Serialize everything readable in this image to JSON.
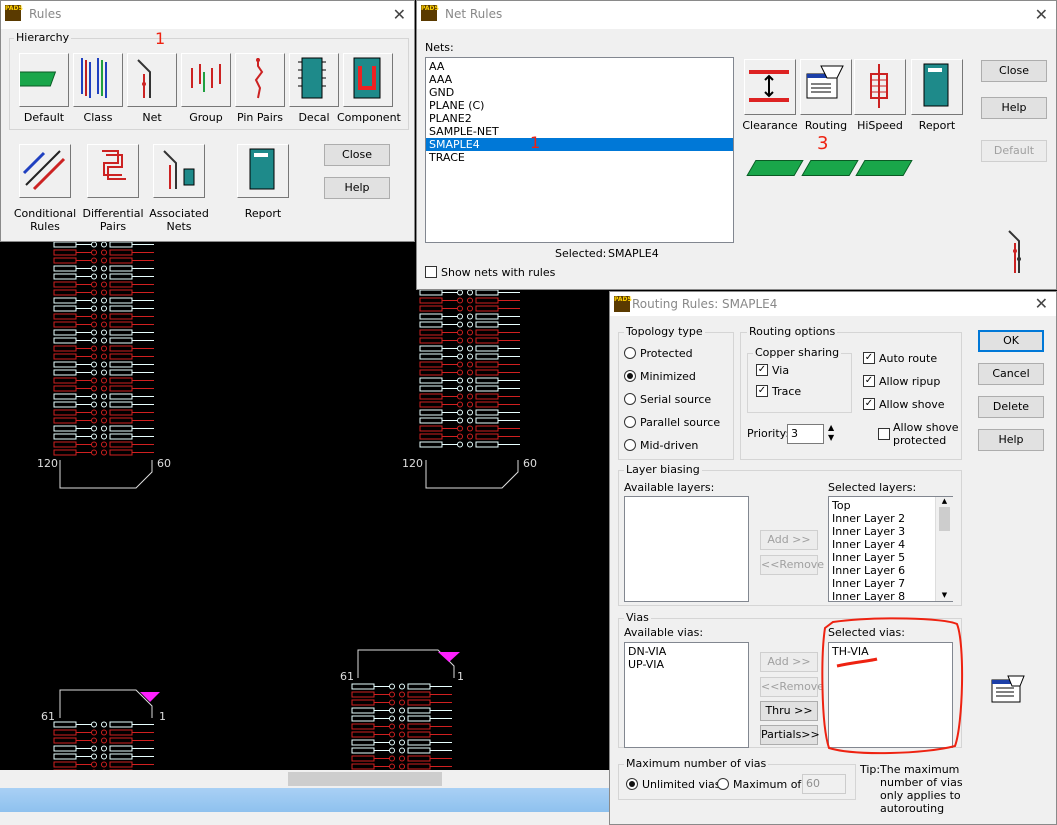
{
  "rules_window": {
    "title": "Rules",
    "hierarchy_label": "Hierarchy",
    "top_buttons": [
      {
        "label": "Default",
        "icon": "default-icon"
      },
      {
        "label": "Class",
        "icon": "class-icon"
      },
      {
        "label": "Net",
        "icon": "net-icon"
      },
      {
        "label": "Group",
        "icon": "group-icon"
      },
      {
        "label": "Pin Pairs",
        "icon": "pin-pairs-icon"
      },
      {
        "label": "Decal",
        "icon": "decal-icon"
      },
      {
        "label": "Component",
        "icon": "component-icon"
      }
    ],
    "bottom_buttons": [
      {
        "label_line1": "Conditional",
        "label_line2": "Rules"
      },
      {
        "label_line1": "Differential",
        "label_line2": "Pairs"
      },
      {
        "label_line1": "Associated",
        "label_line2": "Nets"
      },
      {
        "label_line1": "Report",
        "label_line2": ""
      }
    ],
    "close_label": "Close",
    "help_label": "Help",
    "annotation": "1"
  },
  "net_rules_window": {
    "title": "Net Rules",
    "nets_label": "Nets:",
    "nets": [
      "AA",
      "AAA",
      "GND",
      "PLANE  (C)",
      "PLANE2",
      "SAMPLE-NET",
      "SMAPLE4",
      "TRACE"
    ],
    "selected_index": 6,
    "selected_label": "Selected:",
    "selected_value": "SMAPLE4",
    "show_nets_label": "Show nets with rules",
    "rule_buttons": [
      {
        "label": "Clearance",
        "icon": "clearance-icon"
      },
      {
        "label": "Routing",
        "icon": "routing-icon"
      },
      {
        "label": "HiSpeed",
        "icon": "hispeed-icon"
      },
      {
        "label": "Report",
        "icon": "report-icon"
      }
    ],
    "close_label": "Close",
    "help_label": "Help",
    "default_label": "Default",
    "annotation_list": "1",
    "annotation_routing": "3"
  },
  "routing_rules_window": {
    "title": "Routing Rules: SMAPLE4",
    "topology_label": "Topology type",
    "topology_options": [
      "Protected",
      "Minimized",
      "Serial source",
      "Parallel source",
      "Mid-driven"
    ],
    "topology_selected": 1,
    "routing_options_label": "Routing options",
    "copper_sharing_label": "Copper sharing",
    "via_label": "Via",
    "trace_label": "Trace",
    "auto_route_label": "Auto route",
    "allow_ripup_label": "Allow ripup",
    "allow_shove_label": "Allow shove",
    "allow_shove_protected_line1": "Allow shove",
    "allow_shove_protected_line2": "protected",
    "priority_label": "Priority:",
    "priority_value": "3",
    "layer_biasing_label": "Layer biasing",
    "available_layers_label": "Available layers:",
    "selected_layers_label": "Selected layers:",
    "selected_layers": [
      "Top",
      "Inner Layer 2",
      "Inner Layer 3",
      "Inner Layer 4",
      "Inner Layer 5",
      "Inner Layer 6",
      "Inner Layer 7",
      "Inner Layer 8"
    ],
    "add_label": "Add >>",
    "remove_label": "<<Remove",
    "vias_label": "Vias",
    "available_vias_label": "Available vias:",
    "available_vias": [
      "DN-VIA",
      "UP-VIA"
    ],
    "selected_vias_label": "Selected vias:",
    "selected_vias": [
      "TH-VIA"
    ],
    "thru_label": "Thru >>",
    "partials_label": "Partials>>",
    "max_vias_label": "Maximum number of vias",
    "unlimited_label": "Unlimited vias",
    "maximum_of_label": "Maximum of:",
    "maximum_value": "60",
    "tip_label": "Tip:",
    "tip_lines": [
      "The maximum",
      "number of vias",
      "only applies to",
      "autorouting"
    ],
    "ok_label": "OK",
    "cancel_label": "Cancel",
    "delete_label": "Delete",
    "help_label": "Help"
  },
  "pcb_canvas": {
    "labels": {
      "l120a": "120",
      "l60a": "60",
      "l120b": "120",
      "l60b": "60",
      "l61a": "61",
      "l1a": "1",
      "l61b": "61",
      "l1b": "1"
    }
  }
}
